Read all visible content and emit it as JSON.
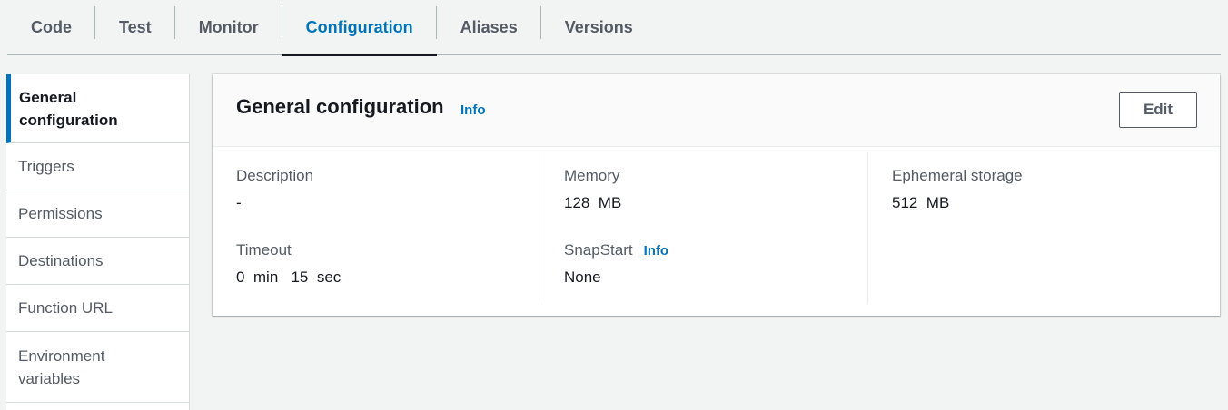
{
  "tabs": [
    {
      "label": "Code"
    },
    {
      "label": "Test"
    },
    {
      "label": "Monitor"
    },
    {
      "label": "Configuration",
      "active": true
    },
    {
      "label": "Aliases"
    },
    {
      "label": "Versions"
    }
  ],
  "sidebar": {
    "items": [
      {
        "label": "General\nconfiguration",
        "active": true
      },
      {
        "label": "Triggers"
      },
      {
        "label": "Permissions"
      },
      {
        "label": "Destinations"
      },
      {
        "label": "Function URL"
      },
      {
        "label": "Environment\nvariables"
      }
    ]
  },
  "panel": {
    "title": "General configuration",
    "info_label": "Info",
    "edit_label": "Edit",
    "fields": {
      "description": {
        "label": "Description",
        "value": "-"
      },
      "timeout": {
        "label": "Timeout",
        "value": "0  min   15  sec"
      },
      "memory": {
        "label": "Memory",
        "value": "128  MB"
      },
      "snapstart": {
        "label": "SnapStart",
        "info_label": "Info",
        "value": "None"
      },
      "ephemeral_storage": {
        "label": "Ephemeral storage",
        "value": "512  MB"
      }
    }
  },
  "colors": {
    "accent": "#0073bb",
    "text": "#16191f",
    "muted": "#545b64",
    "background": "#f2f3f3"
  }
}
